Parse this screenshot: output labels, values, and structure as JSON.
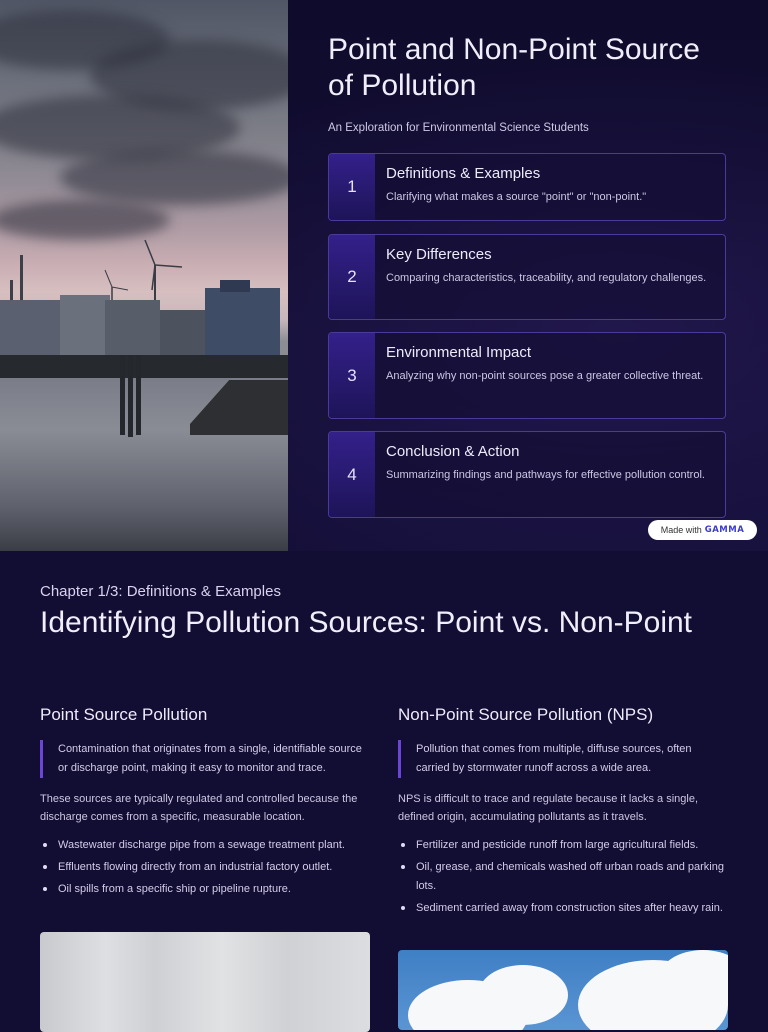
{
  "slide1": {
    "title": "Point and Non-Point Source of Pollution",
    "subtitle": "An Exploration for Environmental Science Students",
    "cards": [
      {
        "num": "1",
        "title": "Definitions & Examples",
        "desc": "Clarifying what makes a source \"point\" or \"non-point.\""
      },
      {
        "num": "2",
        "title": "Key Differences",
        "desc": "Comparing characteristics, traceability, and regulatory challenges."
      },
      {
        "num": "3",
        "title": "Environmental Impact",
        "desc": "Analyzing why non-point sources pose a greater collective threat."
      },
      {
        "num": "4",
        "title": "Conclusion & Action",
        "desc": "Summarizing findings and pathways for effective pollution control."
      }
    ],
    "badge": {
      "prefix": "Made with",
      "brand": "GAMMA"
    }
  },
  "slide2": {
    "chapter": "Chapter 1/3: Definitions & Examples",
    "heading": "Identifying Pollution Sources: Point vs. Non-Point",
    "left": {
      "title": "Point Source Pollution",
      "quote": "Contamination that originates from a single, identifiable source or discharge point, making it easy to monitor and trace.",
      "para": "These sources are typically regulated and controlled because the discharge comes from a specific, measurable location.",
      "bullets": [
        "Wastewater discharge pipe from a sewage treatment plant.",
        "Effluents flowing directly from an industrial factory outlet.",
        "Oil spills from a specific ship or pipeline rupture."
      ]
    },
    "right": {
      "title": "Non-Point Source Pollution (NPS)",
      "quote": "Pollution that comes from multiple, diffuse sources, often carried by stormwater runoff across a wide area.",
      "para": "NPS is difficult to trace and regulate because it lacks a single, defined origin, accumulating pollutants as it travels.",
      "bullets": [
        "Fertilizer and pesticide runoff from large agricultural fields.",
        "Oil, grease, and chemicals washed off urban roads and parking lots.",
        "Sediment carried away from construction sites after heavy rain."
      ]
    }
  },
  "colors": {
    "background": "#120d33",
    "accent": "#6b46d6",
    "card_border": "#4b3a9a"
  }
}
